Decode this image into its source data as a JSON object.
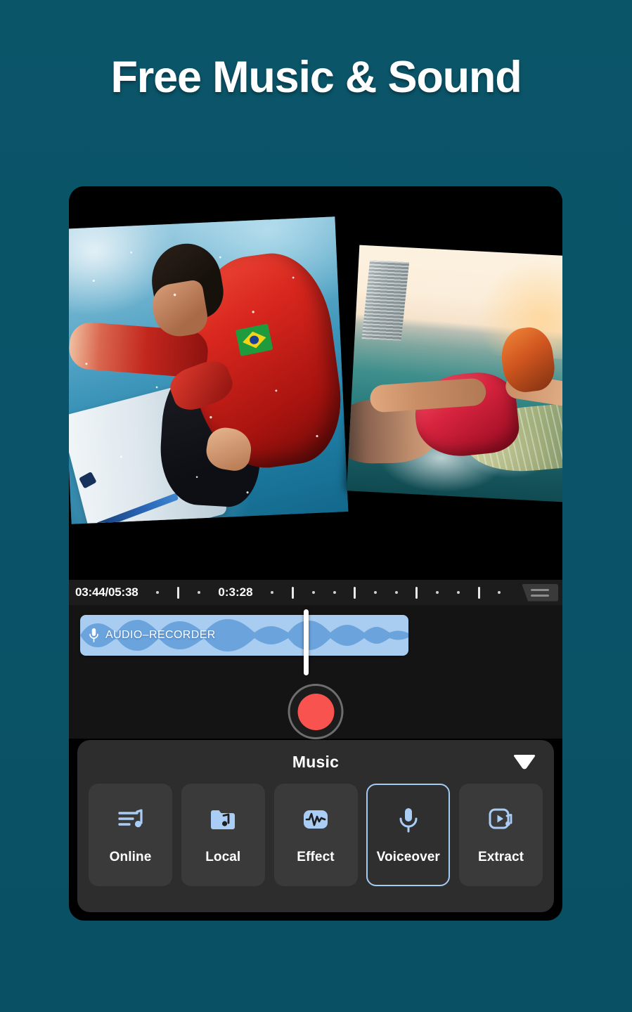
{
  "headline": "Free Music & Sound",
  "theme": {
    "background": "#0a5368",
    "accent": "#a4cbf2",
    "record": "#f9534f",
    "clip_fill": "#a9cdf0",
    "clip_wave": "#6ba3dd",
    "sheet_bg": "#2d2d2d",
    "tool_bg": "#3a3a3a"
  },
  "preview": {
    "left_clip_name": "surfer-clip",
    "right_clip_name": "wakeboard-clip"
  },
  "timeline": {
    "current_total": "03:44/05:38",
    "marker_time": "0:3:28",
    "handle_name": "timeline-zoom-handle",
    "ticks": [
      "dot",
      "bar",
      "dot",
      "label",
      "dot",
      "bar",
      "dot",
      "dot",
      "bar",
      "dot",
      "dot",
      "bar",
      "dot",
      "dot",
      "bar",
      "dot"
    ]
  },
  "track": {
    "clip_label": "AUDIO–RECORDER",
    "clip_icon": "microphone-icon",
    "playhead_name": "playhead"
  },
  "record": {
    "label": "record-button"
  },
  "sheet": {
    "title": "Music",
    "collapse_icon": "chevron-down-icon",
    "tools": [
      {
        "label": "Online",
        "icon": "music-list-icon",
        "selected": false
      },
      {
        "label": "Local",
        "icon": "music-folder-icon",
        "selected": false
      },
      {
        "label": "Effect",
        "icon": "waveform-icon",
        "selected": false
      },
      {
        "label": "Voiceover",
        "icon": "microphone-icon",
        "selected": true
      },
      {
        "label": "Extract",
        "icon": "video-music-icon",
        "selected": false
      }
    ]
  }
}
